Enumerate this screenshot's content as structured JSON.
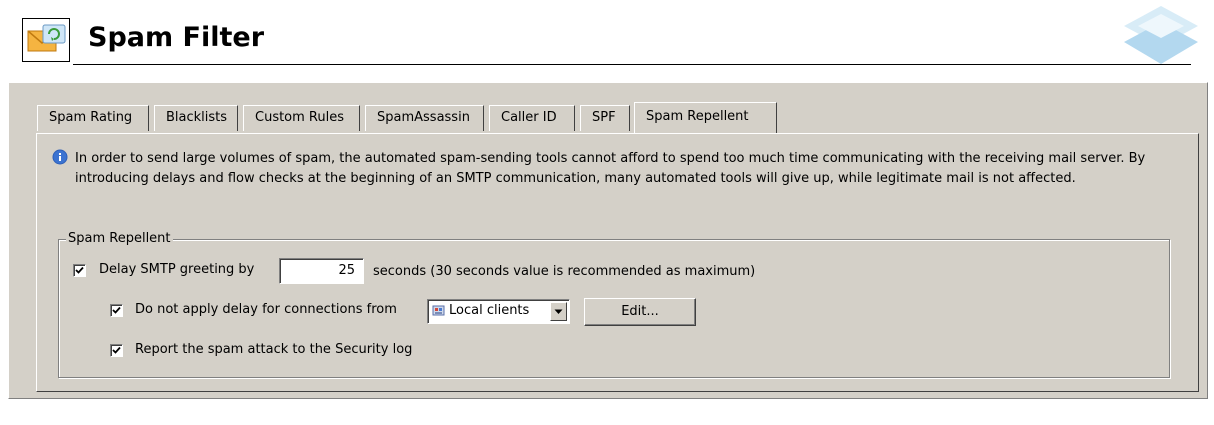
{
  "header": {
    "title": "Spam Filter",
    "icon": "spam-filter-envelope-icon"
  },
  "tabs": [
    {
      "label": "Spam Rating",
      "active": false
    },
    {
      "label": "Blacklists",
      "active": false
    },
    {
      "label": "Custom Rules",
      "active": false
    },
    {
      "label": "SpamAssassin",
      "active": false
    },
    {
      "label": "Caller ID",
      "active": false
    },
    {
      "label": "SPF",
      "active": false
    },
    {
      "label": "Spam Repellent",
      "active": true
    }
  ],
  "info": {
    "icon": "info-icon",
    "text": "In order to send large volumes of spam, the automated spam-sending tools cannot afford to spend too much time communicating with the receiving mail server. By introducing delays and flow checks at the beginning of an SMTP communication, many automated tools will give up, while legitimate mail is not affected."
  },
  "group": {
    "label": "Spam Repellent",
    "delay": {
      "checked": true,
      "label": "Delay SMTP greeting by",
      "value": "25",
      "suffix": "seconds (30 seconds value is recommended as maximum)"
    },
    "exclude": {
      "checked": true,
      "label": "Do not apply delay for connections from",
      "selected": "Local clients",
      "edit_label": "Edit..."
    },
    "report": {
      "checked": true,
      "label": "Report the spam attack to the Security log"
    }
  },
  "colors": {
    "panel": "#d4d0c8",
    "info_blue": "#2d5fb8"
  }
}
